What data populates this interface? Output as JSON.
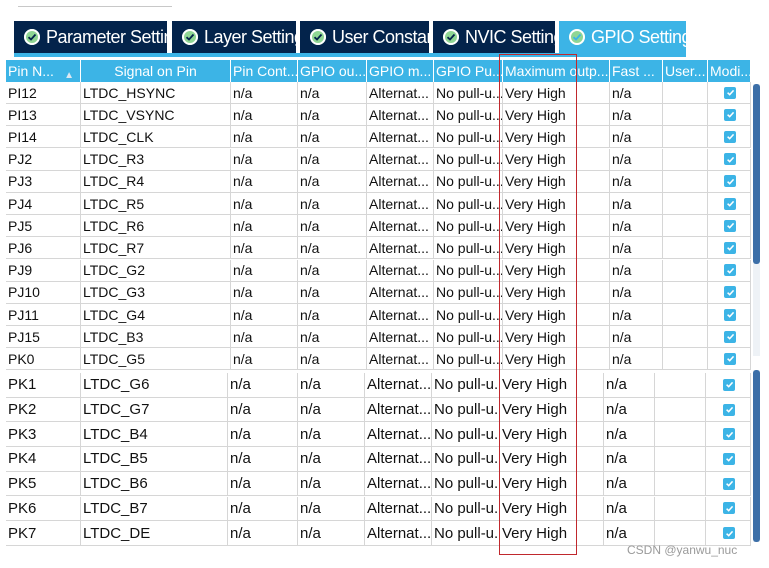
{
  "tabs": [
    {
      "label": "Parameter Settings",
      "active": false
    },
    {
      "label": "Layer Settings",
      "active": false
    },
    {
      "label": "User Constants",
      "active": false
    },
    {
      "label": "NVIC Settings",
      "active": false
    },
    {
      "label": "GPIO Settings",
      "active": true
    }
  ],
  "columns": [
    "Pin N...",
    "Signal on Pin",
    "Pin Cont...",
    "GPIO ou...",
    "GPIO m...",
    "GPIO Pu...",
    "Maximum outp...",
    "Fast ...",
    "User...",
    "Modi..."
  ],
  "rows_top": [
    {
      "pin": "PI12",
      "signal": "LTDC_HSYNC",
      "ctx": "n/a",
      "out": "n/a",
      "mode": "Alternat...",
      "pull": "No pull-u...",
      "speed": "Very High",
      "fast": "n/a",
      "user": "",
      "mod": true
    },
    {
      "pin": "PI13",
      "signal": "LTDC_VSYNC",
      "ctx": "n/a",
      "out": "n/a",
      "mode": "Alternat...",
      "pull": "No pull-u...",
      "speed": "Very High",
      "fast": "n/a",
      "user": "",
      "mod": true
    },
    {
      "pin": "PI14",
      "signal": "LTDC_CLK",
      "ctx": "n/a",
      "out": "n/a",
      "mode": "Alternat...",
      "pull": "No pull-u...",
      "speed": "Very High",
      "fast": "n/a",
      "user": "",
      "mod": true
    },
    {
      "pin": "PJ2",
      "signal": "LTDC_R3",
      "ctx": "n/a",
      "out": "n/a",
      "mode": "Alternat...",
      "pull": "No pull-u...",
      "speed": "Very High",
      "fast": "n/a",
      "user": "",
      "mod": true
    },
    {
      "pin": "PJ3",
      "signal": "LTDC_R4",
      "ctx": "n/a",
      "out": "n/a",
      "mode": "Alternat...",
      "pull": "No pull-u...",
      "speed": "Very High",
      "fast": "n/a",
      "user": "",
      "mod": true
    },
    {
      "pin": "PJ4",
      "signal": "LTDC_R5",
      "ctx": "n/a",
      "out": "n/a",
      "mode": "Alternat...",
      "pull": "No pull-u...",
      "speed": "Very High",
      "fast": "n/a",
      "user": "",
      "mod": true
    },
    {
      "pin": "PJ5",
      "signal": "LTDC_R6",
      "ctx": "n/a",
      "out": "n/a",
      "mode": "Alternat...",
      "pull": "No pull-u...",
      "speed": "Very High",
      "fast": "n/a",
      "user": "",
      "mod": true
    },
    {
      "pin": "PJ6",
      "signal": "LTDC_R7",
      "ctx": "n/a",
      "out": "n/a",
      "mode": "Alternat...",
      "pull": "No pull-u...",
      "speed": "Very High",
      "fast": "n/a",
      "user": "",
      "mod": true
    },
    {
      "pin": "PJ9",
      "signal": "LTDC_G2",
      "ctx": "n/a",
      "out": "n/a",
      "mode": "Alternat...",
      "pull": "No pull-u...",
      "speed": "Very High",
      "fast": "n/a",
      "user": "",
      "mod": true
    },
    {
      "pin": "PJ10",
      "signal": "LTDC_G3",
      "ctx": "n/a",
      "out": "n/a",
      "mode": "Alternat...",
      "pull": "No pull-u...",
      "speed": "Very High",
      "fast": "n/a",
      "user": "",
      "mod": true
    },
    {
      "pin": "PJ11",
      "signal": "LTDC_G4",
      "ctx": "n/a",
      "out": "n/a",
      "mode": "Alternat...",
      "pull": "No pull-u...",
      "speed": "Very High",
      "fast": "n/a",
      "user": "",
      "mod": true
    },
    {
      "pin": "PJ15",
      "signal": "LTDC_B3",
      "ctx": "n/a",
      "out": "n/a",
      "mode": "Alternat...",
      "pull": "No pull-u...",
      "speed": "Very High",
      "fast": "n/a",
      "user": "",
      "mod": true
    },
    {
      "pin": "PK0",
      "signal": "LTDC_G5",
      "ctx": "n/a",
      "out": "n/a",
      "mode": "Alternat...",
      "pull": "No pull-u...",
      "speed": "Very High",
      "fast": "n/a",
      "user": "",
      "mod": true
    }
  ],
  "rows_bottom": [
    {
      "pin": "PK1",
      "signal": "LTDC_G6",
      "ctx": "n/a",
      "out": "n/a",
      "mode": "Alternat...",
      "pull": "No pull-u...",
      "speed": "Very High",
      "fast": "n/a",
      "user": "",
      "mod": true
    },
    {
      "pin": "PK2",
      "signal": "LTDC_G7",
      "ctx": "n/a",
      "out": "n/a",
      "mode": "Alternat...",
      "pull": "No pull-u...",
      "speed": "Very High",
      "fast": "n/a",
      "user": "",
      "mod": true
    },
    {
      "pin": "PK3",
      "signal": "LTDC_B4",
      "ctx": "n/a",
      "out": "n/a",
      "mode": "Alternat...",
      "pull": "No pull-u...",
      "speed": "Very High",
      "fast": "n/a",
      "user": "",
      "mod": true
    },
    {
      "pin": "PK4",
      "signal": "LTDC_B5",
      "ctx": "n/a",
      "out": "n/a",
      "mode": "Alternat...",
      "pull": "No pull-u...",
      "speed": "Very High",
      "fast": "n/a",
      "user": "",
      "mod": true
    },
    {
      "pin": "PK5",
      "signal": "LTDC_B6",
      "ctx": "n/a",
      "out": "n/a",
      "mode": "Alternat...",
      "pull": "No pull-u...",
      "speed": "Very High",
      "fast": "n/a",
      "user": "",
      "mod": true
    },
    {
      "pin": "PK6",
      "signal": "LTDC_B7",
      "ctx": "n/a",
      "out": "n/a",
      "mode": "Alternat...",
      "pull": "No pull-u...",
      "speed": "Very High",
      "fast": "n/a",
      "user": "",
      "mod": true
    },
    {
      "pin": "PK7",
      "signal": "LTDC_DE",
      "ctx": "n/a",
      "out": "n/a",
      "mode": "Alternat...",
      "pull": "No pull-u...",
      "speed": "Very High",
      "fast": "n/a",
      "user": "",
      "mod": true
    }
  ],
  "watermark": "CSDN @yanwu_nuc",
  "colors": {
    "accent": "#3cb4e6",
    "dark_tab": "#03234b",
    "highlight_box": "#c0282d"
  }
}
